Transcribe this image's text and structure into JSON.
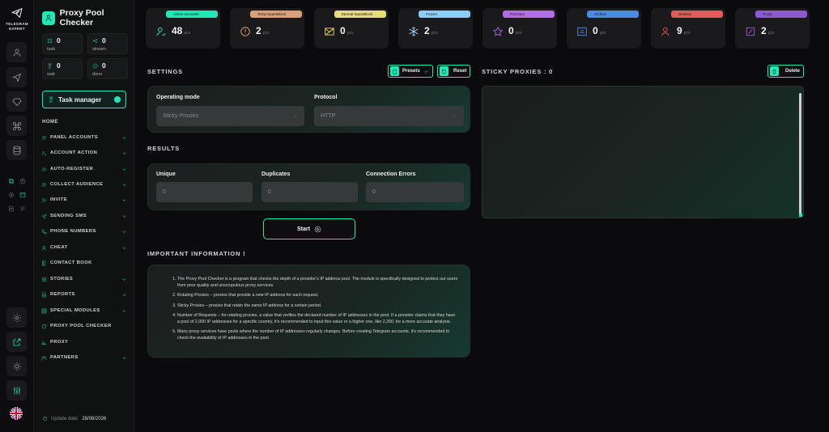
{
  "brand": {
    "line1": "TELEGRAM",
    "line2": "EXPERT"
  },
  "app": {
    "title": "Proxy Pool Checker"
  },
  "mini_stats": [
    {
      "icon": "task-icon",
      "value": "0",
      "label": "task"
    },
    {
      "icon": "stream-icon",
      "value": "0",
      "label": "stream"
    },
    {
      "icon": "hourglass-icon",
      "value": "0",
      "label": "wait"
    },
    {
      "icon": "check-circle-icon",
      "value": "0",
      "label": "done"
    }
  ],
  "task_manager": {
    "label": "Task manager"
  },
  "nav": {
    "home": "HOME",
    "items": [
      {
        "label": "PANEL ACCOUNTS",
        "icon": "users-icon"
      },
      {
        "label": "ACCOUNT ACTION",
        "icon": "user-cog-icon"
      },
      {
        "label": "AUTO-REGISTER",
        "icon": "user-plus-icon"
      },
      {
        "label": "COLLECT AUDIENCE",
        "icon": "users-icon"
      },
      {
        "label": "INVITE",
        "icon": "user-add-icon"
      },
      {
        "label": "SENDING SMS",
        "icon": "send-icon"
      },
      {
        "label": "PHONE NUMBERS",
        "icon": "phone-icon"
      },
      {
        "label": "CHEAT",
        "icon": "user-icon"
      },
      {
        "label": "CONTACT BOOK",
        "icon": "book-icon"
      },
      {
        "label": "STORIES",
        "icon": "stories-icon"
      },
      {
        "label": "REPORTS",
        "icon": "reports-icon"
      },
      {
        "label": "SPECIAL MODULES",
        "icon": "grid-icon"
      },
      {
        "label": "PROXY POOL CHECKER",
        "icon": "refresh-icon"
      },
      {
        "label": "PROXY",
        "icon": "proxy-icon"
      },
      {
        "label": "PARTNERS",
        "icon": "partners-icon"
      }
    ]
  },
  "update": {
    "label": "Update date:",
    "date": "28/08/2026"
  },
  "cards": [
    {
      "label": "Active accounts",
      "value": "48",
      "unit": "pcs",
      "color": "#1de9b6",
      "icon_color": "#1de9b6",
      "icon": "user-check-icon"
    },
    {
      "label": "Temp SpamBlock",
      "value": "2",
      "unit": "pcs",
      "color": "#d9a07a",
      "icon_color": "#e8a572",
      "icon": "alert-icon"
    },
    {
      "label": "Eternal SpamBlock",
      "value": "0",
      "unit": "pcs",
      "color": "#e8dc7a",
      "icon_color": "#e5d35a",
      "icon": "mail-block-icon"
    },
    {
      "label": "Frozen",
      "value": "2",
      "unit": "pcs",
      "color": "#8ecbf5",
      "icon_color": "#9bd3f7",
      "icon": "snowflake-icon"
    },
    {
      "label": "Premium",
      "value": "0",
      "unit": "pcs",
      "color": "#b06ee0",
      "icon_color": "#a561e0",
      "icon": "star-icon"
    },
    {
      "label": "Archive",
      "value": "0",
      "unit": "pcs",
      "color": "#4f87e6",
      "icon_color": "#4d8ae8",
      "icon": "archive-icon"
    },
    {
      "label": "Deleted",
      "value": "9",
      "unit": "pcs",
      "color": "#e45a5a",
      "icon_color": "#ea5b5b",
      "icon": "user-x-icon"
    },
    {
      "label": "Proxy",
      "value": "2",
      "unit": "pcs",
      "color": "#8c58d6",
      "icon_color": "#9b5ee0",
      "icon": "proxy-card-icon"
    }
  ],
  "settings": {
    "title": "SETTINGS",
    "presets_label": "Presets",
    "reset_label": "Reset",
    "mode_label": "Operating mode",
    "mode_value": "Sticky Proxies",
    "protocol_label": "Protocol",
    "protocol_value": "HTTP"
  },
  "results": {
    "title": "RESULTS",
    "unique_label": "Unique",
    "unique_value": "0",
    "duplicates_label": "Duplicates",
    "duplicates_value": "0",
    "errors_label": "Connection Errors",
    "errors_value": "0"
  },
  "start_label": "Start",
  "info": {
    "title": "IMPORTANT INFORMATION !",
    "items": [
      "The Proxy Pool Checker is a program that checks the depth of a provider's IP address pool. The module is specifically designed to protect our users from poor quality and unscrupulous proxy services.",
      "Rotating Proxies – proxies that provide a new IP address for each request.",
      "Sticky Proxies – proxies that retain the same IP address for a certain period.",
      "Number of Requests – for rotating proxies, a value that verifies the declared number of IP addresses in the pool. If a provider claims that they have a pool of 2,000 IP addresses for a specific country, it's recommended to input this value or a higher one, like 2,200, for a more accurate analysis.",
      "Many proxy services have pools where the number of IP addresses regularly changes. Before creating Telegram accounts, it's recommended to check the availability of IP addresses in the pool."
    ]
  },
  "sticky": {
    "title": "STICKY PROXIES : 0",
    "delete_label": "Delete"
  }
}
